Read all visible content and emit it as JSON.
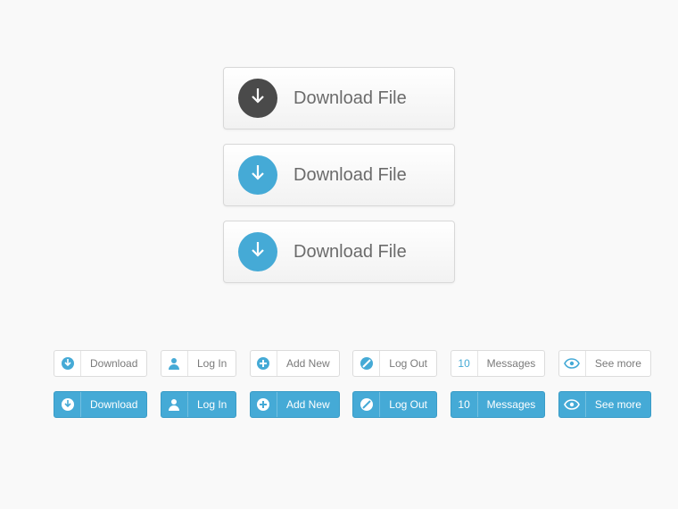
{
  "large_buttons": [
    {
      "label": "Download File",
      "icon": "download",
      "color": "dark"
    },
    {
      "label": "Download File",
      "icon": "download",
      "color": "blue"
    },
    {
      "label": "Download File",
      "icon": "download",
      "color": "blue"
    }
  ],
  "small_rows": {
    "light": [
      {
        "icon": "download",
        "label": "Download"
      },
      {
        "icon": "user",
        "label": "Log In"
      },
      {
        "icon": "plus",
        "label": "Add New"
      },
      {
        "icon": "slash",
        "label": "Log Out"
      },
      {
        "badge": "10",
        "label": "Messages"
      },
      {
        "icon": "eye",
        "label": "See more"
      }
    ],
    "blue": [
      {
        "icon": "download",
        "label": "Download"
      },
      {
        "icon": "user",
        "label": "Log In"
      },
      {
        "icon": "plus",
        "label": "Add New"
      },
      {
        "icon": "slash",
        "label": "Log Out"
      },
      {
        "badge": "10",
        "label": "Messages"
      },
      {
        "icon": "eye",
        "label": "See more"
      }
    ]
  },
  "colors": {
    "accent_blue": "#45aad6",
    "dark_gray": "#4a4a4a"
  }
}
